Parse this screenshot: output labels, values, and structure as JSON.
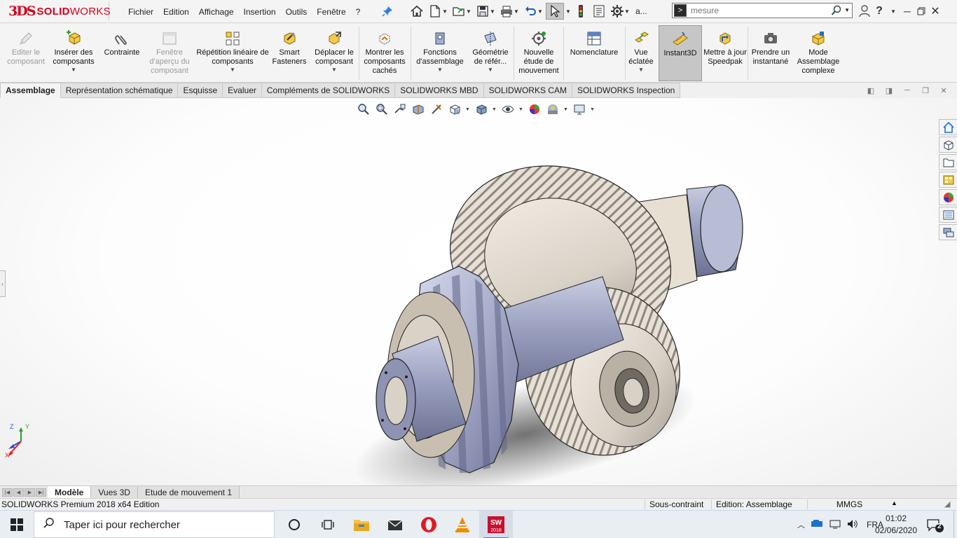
{
  "app": {
    "brand_prefix": "3DS",
    "brand_bold": "SOLID",
    "brand_light": "WORKS"
  },
  "menu": [
    "Fichier",
    "Edition",
    "Affichage",
    "Insertion",
    "Outils",
    "Fenêtre",
    "?"
  ],
  "qat": {
    "overflow_label": "a..."
  },
  "search": {
    "value": "",
    "placeholder": "mesure"
  },
  "ribbon": {
    "buttons": [
      {
        "label": "Editer le composant",
        "icon": "edit-component-icon",
        "disabled": true
      },
      {
        "label": "Insérer des composants",
        "icon": "insert-components-icon",
        "dropdown": true
      },
      {
        "label": "Contrainte",
        "icon": "mate-paperclip-icon"
      },
      {
        "label": "Fenêtre d'aperçu du composant",
        "icon": "preview-window-icon",
        "disabled": true
      },
      {
        "label": "Répétition linéaire de composants",
        "icon": "linear-pattern-icon",
        "dropdown": true
      },
      {
        "label": "Smart Fasteners",
        "icon": "smart-fasteners-icon"
      },
      {
        "label": "Déplacer le composant",
        "icon": "move-component-icon",
        "dropdown": true
      },
      {
        "label": "Montrer les composants cachés",
        "icon": "show-hidden-icon"
      },
      {
        "label": "Fonctions d'assemblage",
        "icon": "assembly-features-icon",
        "dropdown": true
      },
      {
        "label": "Géométrie de référ...",
        "icon": "reference-geometry-icon",
        "dropdown": true
      },
      {
        "label": "Nouvelle étude de mouvement",
        "icon": "motion-study-icon"
      },
      {
        "label": "Nomenclature",
        "icon": "bom-icon"
      },
      {
        "label": "Vue éclatée",
        "icon": "exploded-view-icon",
        "dropdown": true
      },
      {
        "label": "Instant3D",
        "icon": "instant3d-icon",
        "active": true
      },
      {
        "label": "Mettre à jour Speedpak",
        "icon": "speedpak-icon"
      },
      {
        "label": "Prendre un instantané",
        "icon": "snapshot-camera-icon"
      },
      {
        "label": "Mode Assemblage complexe",
        "icon": "large-assembly-icon"
      }
    ]
  },
  "tabs": [
    "Assemblage",
    "Représentation schématique",
    "Esquisse",
    "Evaluer",
    "Compléments de SOLIDWORKS",
    "SOLIDWORKS MBD",
    "SOLIDWORKS CAM",
    "SOLIDWORKS Inspection"
  ],
  "triad": {
    "z": "Z",
    "y": "Y",
    "x": "X"
  },
  "bottom_tabs": [
    "Modèle",
    "Vues 3D",
    "Etude de mouvement 1"
  ],
  "status": {
    "edition": "SOLIDWORKS Premium 2018 x64 Edition",
    "constraint": "Sous-contraint",
    "mode": "Edition: Assemblage",
    "units": "MMGS"
  },
  "taskbar": {
    "search_placeholder": "Taper ici pour rechercher",
    "apps": [
      "cortana-icon",
      "task-view-icon",
      "file-explorer-icon",
      "mail-icon",
      "opera-icon",
      "vlc-icon",
      "solidworks-icon"
    ],
    "solidworks_badge": "2018",
    "language": "FRA",
    "time": "01:02",
    "date": "02/06/2020",
    "notifications": "2"
  },
  "colors": {
    "brand": "#d6001c",
    "accent": "#1e6fd0",
    "gear": "#d9d2c7",
    "shaft": "#9aa0bf"
  }
}
